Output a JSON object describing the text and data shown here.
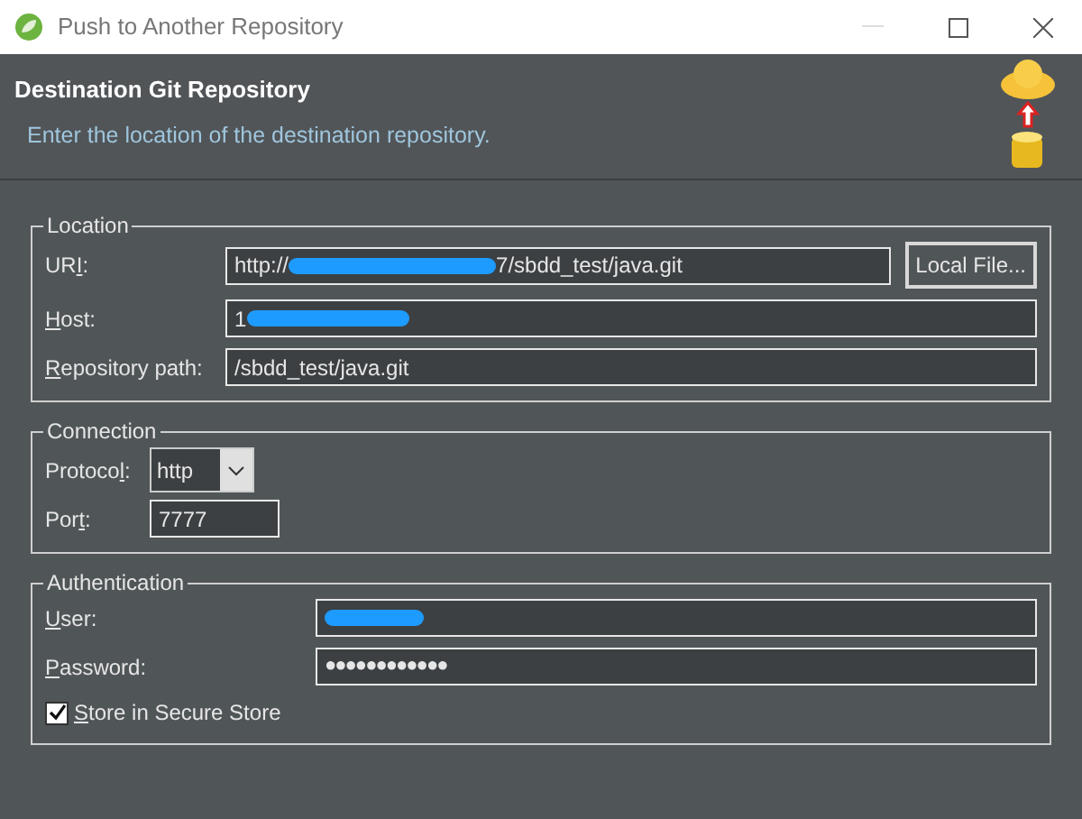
{
  "window": {
    "title": "Push to Another Repository"
  },
  "header": {
    "title": "Destination Git Repository",
    "description": "Enter the location of the destination repository."
  },
  "location": {
    "legend": "Location",
    "uri": {
      "label": {
        "pre": "UR",
        "key": "I",
        "post": ":"
      },
      "value_prefix": "http://",
      "value_suffix": "7/sbdd_test/java.git",
      "redacted": true
    },
    "local_file_button": "Local File...",
    "host": {
      "label": {
        "key": "H",
        "post": "ost:"
      },
      "value_prefix": "1",
      "redacted": true
    },
    "repository_path": {
      "label": {
        "key": "R",
        "post": "epository path:"
      },
      "value": "/sbdd_test/java.git"
    }
  },
  "connection": {
    "legend": "Connection",
    "protocol": {
      "label": {
        "pre": "Protoco",
        "key": "l",
        "post": ":"
      },
      "value": "http"
    },
    "port": {
      "label": {
        "pre": "Por",
        "key": "t",
        "post": ":"
      },
      "value": "7777"
    }
  },
  "authentication": {
    "legend": "Authentication",
    "user": {
      "label": {
        "key": "U",
        "post": "ser:"
      },
      "redacted": true
    },
    "password": {
      "label": {
        "key": "P",
        "post": "assword:"
      },
      "value": "●●●●●●●●●●●●"
    },
    "store": {
      "label": {
        "key": "S",
        "post": "tore in Secure Store"
      },
      "checked": true
    }
  }
}
